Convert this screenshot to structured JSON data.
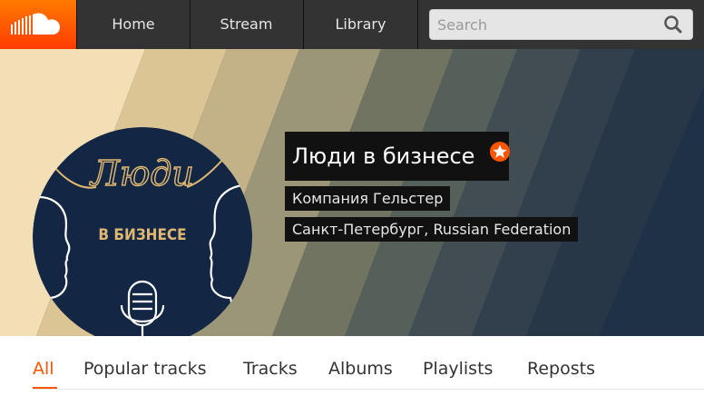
{
  "brand": {
    "logo_icon": "soundcloud-cloud-icon",
    "accent": "#ff5500"
  },
  "nav": {
    "items": [
      {
        "label": "Home"
      },
      {
        "label": "Stream"
      },
      {
        "label": "Library"
      }
    ]
  },
  "search": {
    "placeholder": "Search",
    "value": "",
    "icon": "search-icon"
  },
  "profile": {
    "name": "Люди в бизнесе",
    "badge_icon": "pro-star-badge-icon",
    "company": "Компания Гельстер",
    "location": "Санкт-Петербург, Russian Federation",
    "avatar": {
      "script_text": "Люди",
      "text": "В БИЗНЕСЕ",
      "icons": [
        "microphone-icon",
        "face-silhouette-icon"
      ]
    }
  },
  "tabs": {
    "items": [
      {
        "label": "All",
        "active": true
      },
      {
        "label": "Popular tracks"
      },
      {
        "label": "Tracks"
      },
      {
        "label": "Albums"
      },
      {
        "label": "Playlists"
      },
      {
        "label": "Reposts"
      }
    ]
  }
}
